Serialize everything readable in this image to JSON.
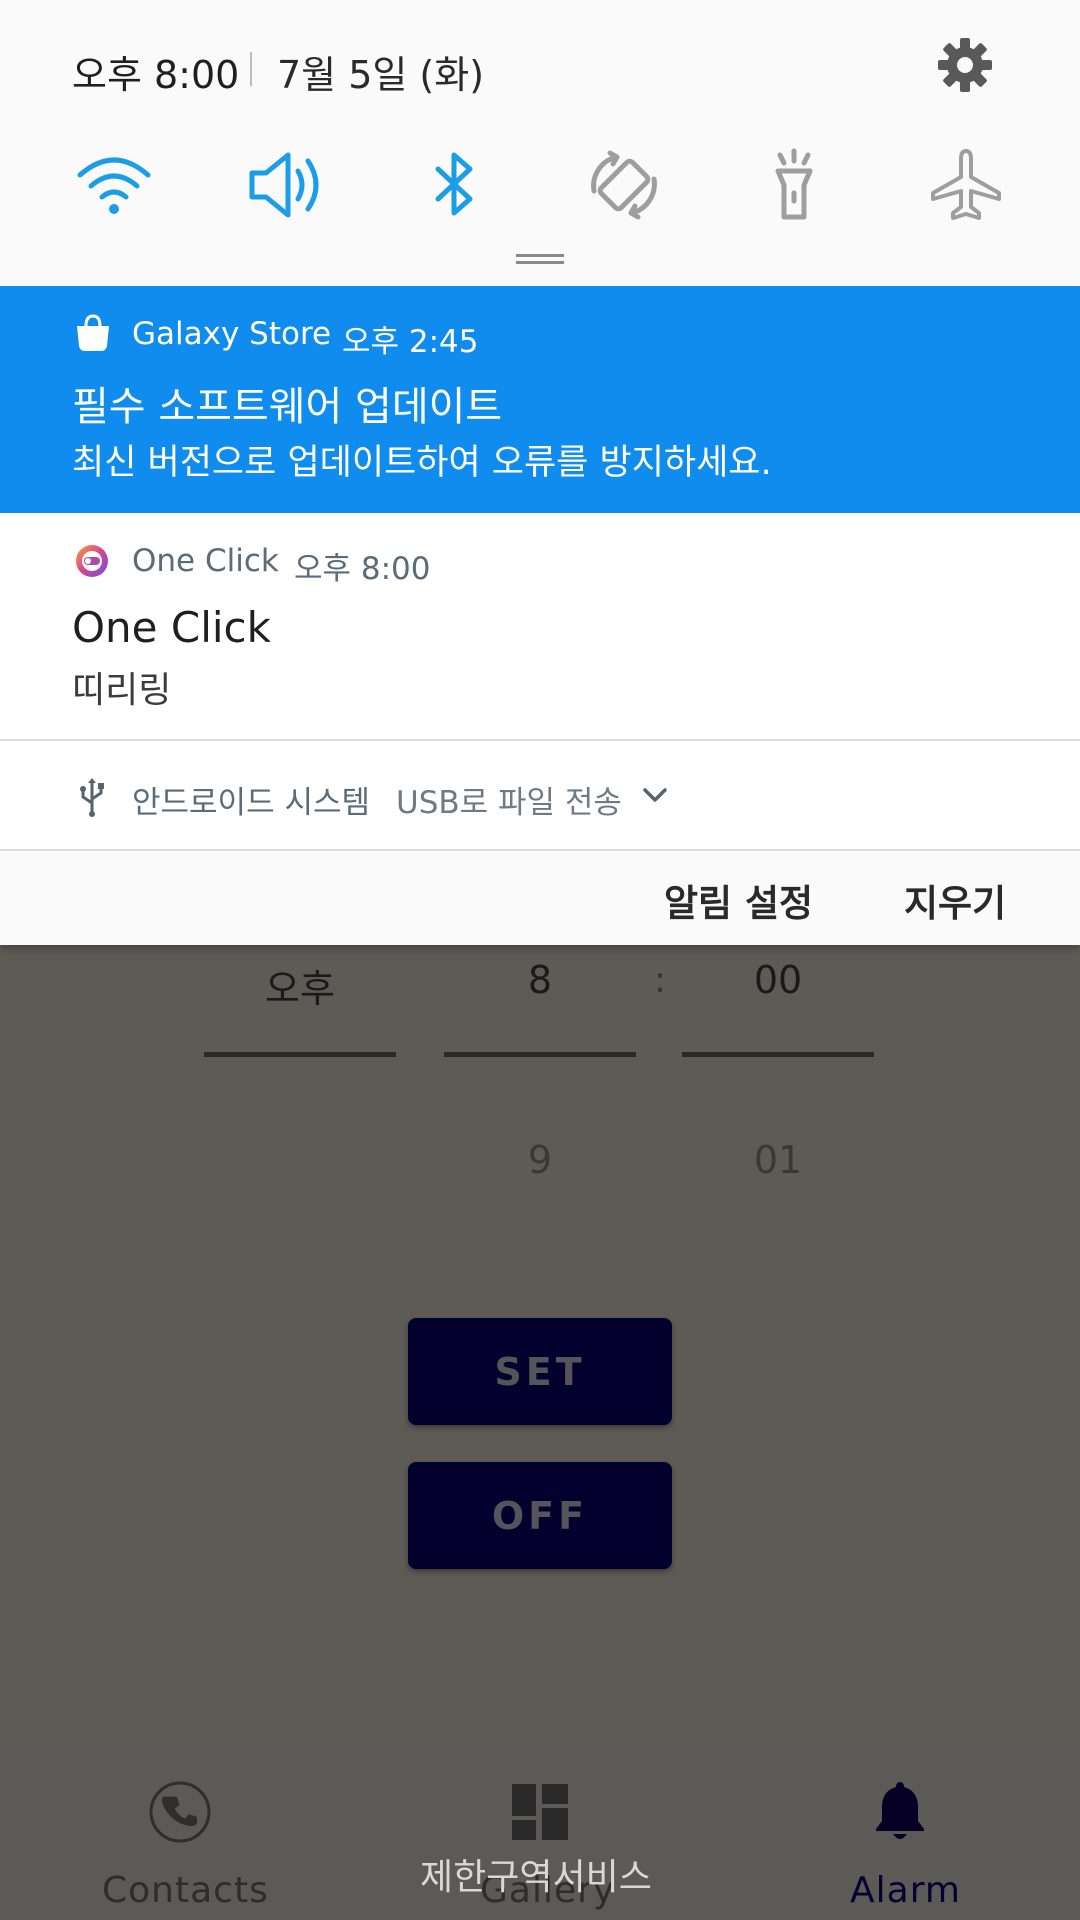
{
  "status_bar": {
    "time": "오후 8:00",
    "date": "7월 5일 (화)",
    "settings_icon": "gear-icon"
  },
  "quick_settings": [
    {
      "name": "wifi",
      "icon": "wifi-icon",
      "active": true
    },
    {
      "name": "sound",
      "icon": "speaker-icon",
      "active": true
    },
    {
      "name": "bluetooth",
      "icon": "bluetooth-icon",
      "active": true
    },
    {
      "name": "auto-rotate",
      "icon": "rotate-icon",
      "active": false
    },
    {
      "name": "flashlight",
      "icon": "flashlight-icon",
      "active": false
    },
    {
      "name": "airplane",
      "icon": "airplane-icon",
      "active": false
    }
  ],
  "notifications": {
    "galaxy_store": {
      "app": "Galaxy Store",
      "time": "오후 2:45",
      "title": "필수 소프트웨어 업데이트",
      "body": "최신 버전으로 업데이트하여 오류를 방지하세요."
    },
    "one_click": {
      "app": "One Click",
      "time": "오후 8:00",
      "title": "One Click",
      "body": "띠리링"
    },
    "usb": {
      "app": "안드로이드 시스템",
      "desc": "USB로 파일 전송"
    }
  },
  "shade_footer": {
    "settings_label": "알림 설정",
    "clear_label": "지우기"
  },
  "alarm_app": {
    "picker": {
      "ampm": "오후",
      "hour": "8",
      "separator": ":",
      "minute": "00",
      "hour_next": "9",
      "minute_next": "01"
    },
    "set_label": "SET",
    "off_label": "OFF",
    "nav": [
      {
        "label": "Contacts",
        "icon": "phone-icon"
      },
      {
        "label": "Gallery",
        "icon": "dashboard-icon"
      },
      {
        "label": "Alarm",
        "icon": "bell-icon"
      }
    ],
    "toast": "제한구역서비스"
  },
  "colors": {
    "accent_blue": "#0f8ced",
    "qs_active": "#1b9de8",
    "qs_inactive": "#9e9e9e",
    "button_bg": "#04002e"
  }
}
